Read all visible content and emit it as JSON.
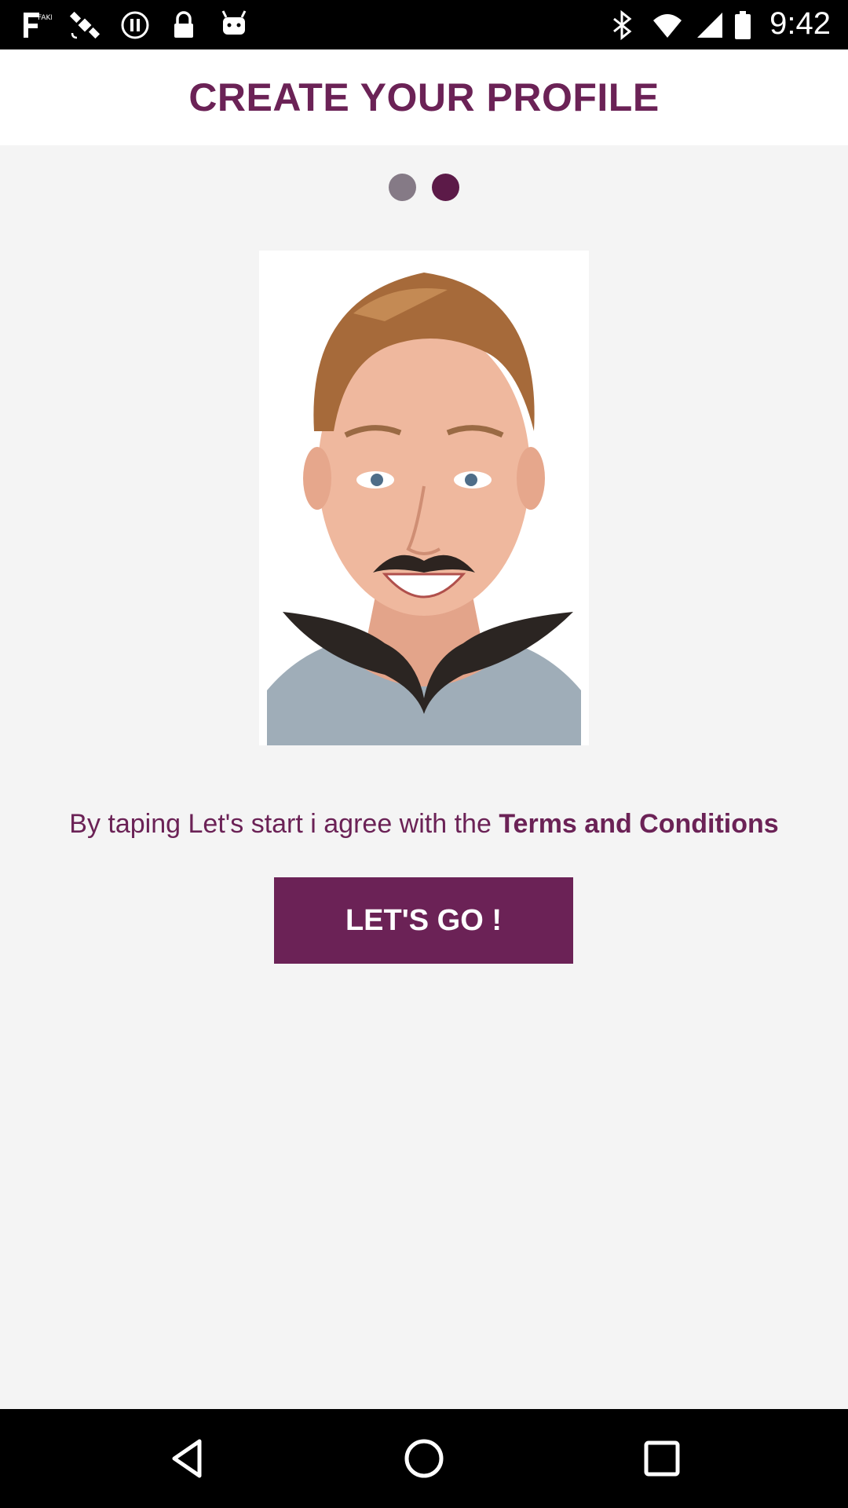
{
  "status_bar": {
    "time": "9:42",
    "left_icons": [
      "fake-gps-icon",
      "satellite-icon",
      "pause-circle-icon",
      "lock-icon",
      "android-icon"
    ],
    "right_icons": [
      "bluetooth-icon",
      "wifi-icon",
      "signal-icon",
      "battery-icon"
    ]
  },
  "header": {
    "title": "CREATE YOUR PROFILE"
  },
  "pager": {
    "total": 2,
    "current": 2
  },
  "profile": {
    "image_alt": ""
  },
  "terms": {
    "prefix": "By taping Let's start i agree with the ",
    "link_text": "Terms and Conditions"
  },
  "cta": {
    "label": "LET'S GO !"
  },
  "colors": {
    "brand": "#6b2256",
    "dot_active": "#5c1a48",
    "dot_inactive": "#857a86",
    "background": "#f4f4f4"
  },
  "nav": {
    "buttons": [
      "back-icon",
      "home-icon",
      "recents-icon"
    ]
  }
}
